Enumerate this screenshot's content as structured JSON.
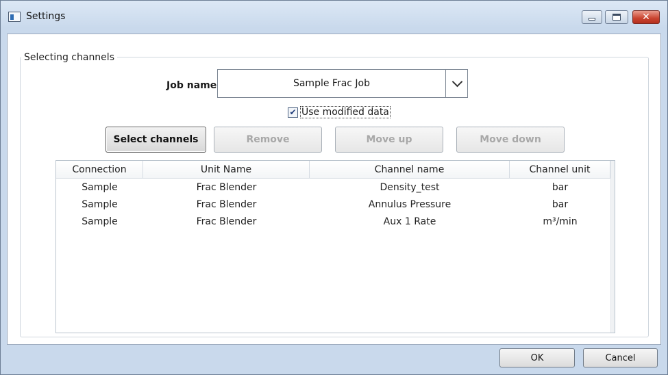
{
  "window": {
    "title": "Settings",
    "icon": "app-window-icon",
    "controls": {
      "minimize": "minimize-icon",
      "maximize": "maximize-icon",
      "close": "close-icon"
    }
  },
  "group": {
    "label": "Selecting channels"
  },
  "job": {
    "label": "Job name:",
    "selected": "Sample Frac Job"
  },
  "options": {
    "use_modified_label": "Use modified data",
    "use_modified_checked": true
  },
  "toolbar": {
    "select_channels": "Select channels",
    "remove": "Remove",
    "move_up": "Move up",
    "move_down": "Move down"
  },
  "table": {
    "columns": [
      "Connection",
      "Unit Name",
      "Channel name",
      "Channel unit"
    ],
    "rows": [
      [
        "Sample",
        "Frac Blender",
        "Density_test",
        "bar"
      ],
      [
        "Sample",
        "Frac Blender",
        "Annulus Pressure",
        "bar"
      ],
      [
        "Sample",
        "Frac Blender",
        "Aux 1 Rate",
        "m³/min"
      ]
    ]
  },
  "footer": {
    "ok": "OK",
    "cancel": "Cancel"
  }
}
